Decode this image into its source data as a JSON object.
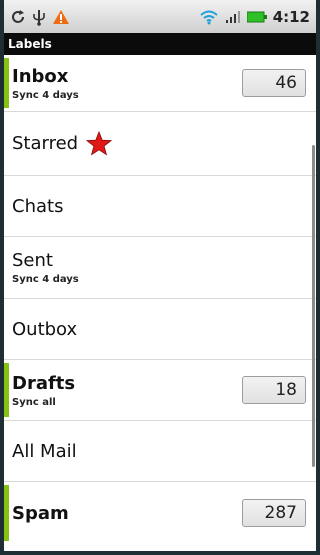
{
  "status_bar": {
    "time": "4:12",
    "icons": [
      "sync-icon",
      "usb-icon",
      "warning-icon",
      "wifi-icon",
      "signal-icon",
      "battery-icon"
    ]
  },
  "title_bar": {
    "title": "Labels"
  },
  "labels": [
    {
      "name": "Inbox",
      "sub": "Sync 4 days",
      "count": "46"
    },
    {
      "name": "Starred",
      "icon": "star-icon"
    },
    {
      "name": "Chats"
    },
    {
      "name": "Sent",
      "sub": "Sync 4 days"
    },
    {
      "name": "Outbox"
    },
    {
      "name": "Drafts",
      "sub": "Sync all",
      "count": "18"
    },
    {
      "name": "All Mail"
    },
    {
      "name": "Spam",
      "count": "287"
    }
  ],
  "colors": {
    "unread_accent": "#86c214",
    "title_bar_bg": "#0b0b0b",
    "star": "#e01818"
  }
}
